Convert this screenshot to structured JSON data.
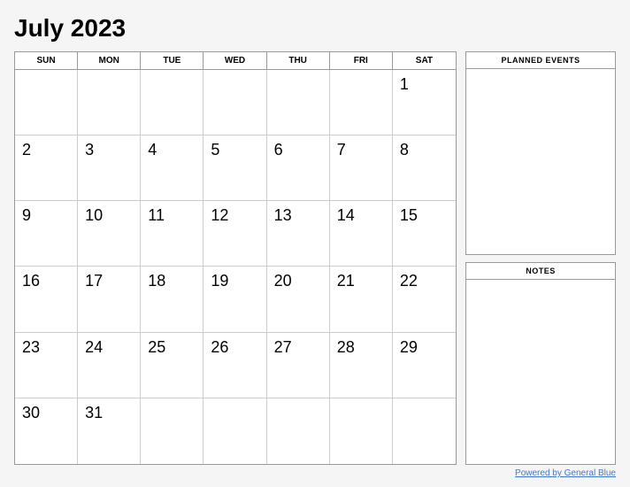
{
  "header": {
    "title": "July 2023"
  },
  "calendar": {
    "day_headers": [
      "SUN",
      "MON",
      "TUE",
      "WED",
      "THU",
      "FRI",
      "SAT"
    ],
    "weeks": [
      [
        null,
        null,
        null,
        null,
        null,
        null,
        1
      ],
      [
        2,
        3,
        4,
        5,
        6,
        7,
        8
      ],
      [
        9,
        10,
        11,
        12,
        13,
        14,
        15
      ],
      [
        16,
        17,
        18,
        19,
        20,
        21,
        22
      ],
      [
        23,
        24,
        25,
        26,
        27,
        28,
        29
      ],
      [
        30,
        31,
        null,
        null,
        null,
        null,
        null
      ]
    ]
  },
  "sidebar": {
    "planned_events_label": "PLANNED EVENTS",
    "notes_label": "NOTES"
  },
  "footer": {
    "link_text": "Powered by General Blue"
  }
}
